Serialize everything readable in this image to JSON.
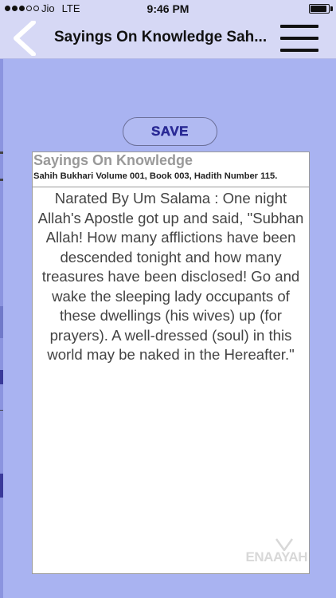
{
  "status_bar": {
    "carrier": "Jio",
    "network": "LTE",
    "time": "9:46 PM",
    "battery_level": 0.9
  },
  "nav": {
    "title": "Sayings On Knowledge Sah..."
  },
  "save_button": {
    "label": "SAVE"
  },
  "card": {
    "heading": "Sayings On Knowledge",
    "reference": "Sahih Bukhari Volume 001, Book 003, Hadith Number 115.",
    "body": "Narated By Um Salama : One night Allah's Apostle got up and said, \"Subhan Allah! How many afflictions have been descended tonight and how many treasures have been disclosed! Go and wake the sleeping lady occupants of these dwellings (his wives) up (for prayers). A well-dressed (soul) in this world may be naked in the Hereafter.\"",
    "watermark": "ENAAYAH"
  },
  "colors": {
    "background": "#a9b3f1",
    "nav_background": "#d6d8f5",
    "save_text": "#2a2a9a"
  }
}
